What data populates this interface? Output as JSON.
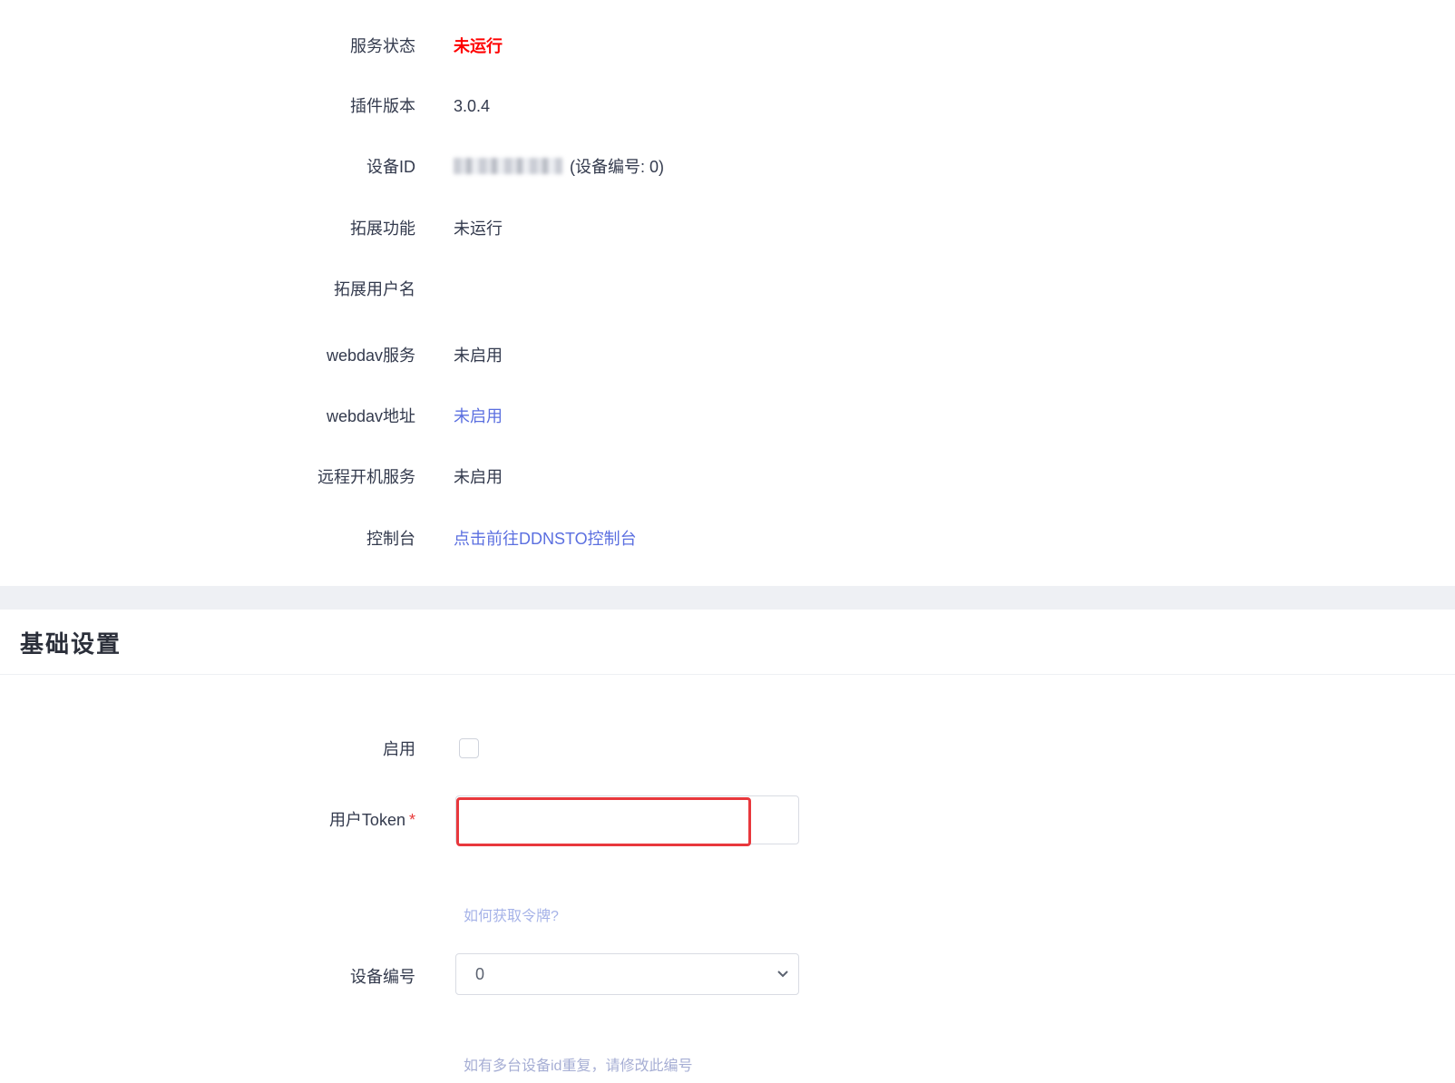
{
  "status": {
    "rows": [
      {
        "label": "服务状态",
        "value": "未运行"
      },
      {
        "label": "插件版本",
        "value": "3.0.4"
      },
      {
        "label": "设备ID",
        "value": "(设备编号: 0)"
      },
      {
        "label": "拓展功能",
        "value": "未运行"
      },
      {
        "label": "拓展用户名",
        "value": ""
      },
      {
        "label": "webdav服务",
        "value": "未启用"
      },
      {
        "label": "webdav地址",
        "value": "未启用"
      },
      {
        "label": "远程开机服务",
        "value": "未启用"
      },
      {
        "label": "控制台",
        "value": "点击前往DDNSTO控制台"
      }
    ]
  },
  "basic": {
    "title": "基础设置",
    "enable_label": "启用",
    "token_label": "用户Token",
    "token_required": "*",
    "token_value": "",
    "token_help": "如何获取令牌?",
    "device_no_label": "设备编号",
    "device_no_value": "0",
    "device_no_help": "如有多台设备id重复，请修改此编号"
  },
  "colors": {
    "status_stopped": "#ff0000",
    "link": "#5b6fe0",
    "highlight_border": "#e8383d"
  }
}
